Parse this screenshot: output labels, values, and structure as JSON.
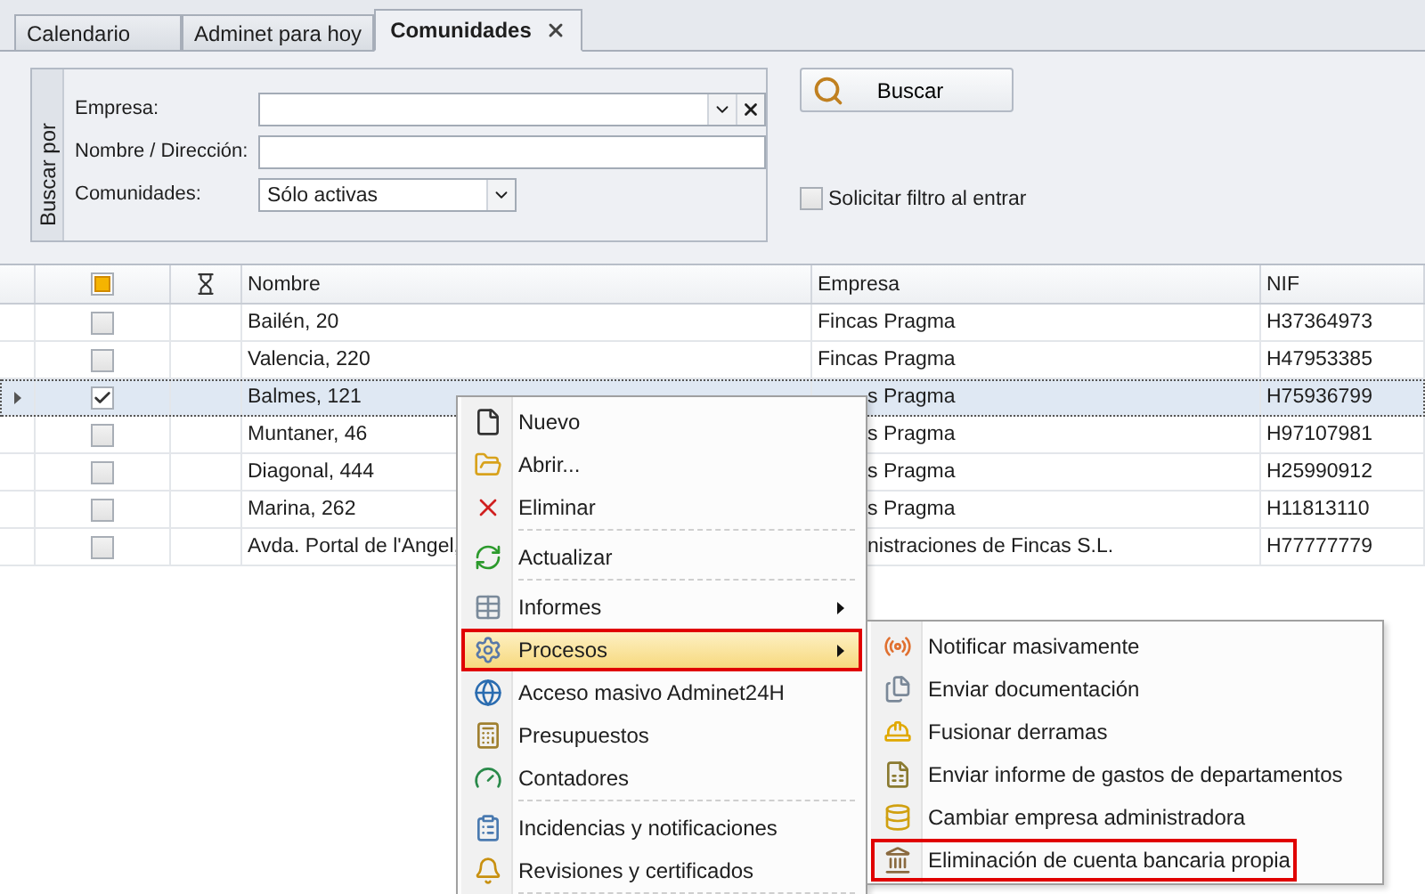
{
  "tabs": [
    {
      "label": "Calendario",
      "selected": false,
      "closable": false
    },
    {
      "label": "Adminet para hoy",
      "selected": false,
      "closable": false
    },
    {
      "label": "Comunidades",
      "selected": true,
      "closable": true
    }
  ],
  "search": {
    "group_label": "Buscar por",
    "fields": [
      {
        "label": "Empresa:",
        "kind": "combo_clear"
      },
      {
        "label": "Nombre / Dirección:",
        "kind": "text"
      },
      {
        "label": "Comunidades:",
        "kind": "select",
        "value": "Sólo activas"
      }
    ],
    "button": "Buscar",
    "checkbox": {
      "label": "Solicitar filtro al entrar",
      "checked": false
    }
  },
  "grid": {
    "header_partial_check": true,
    "columns": [
      "Nombre",
      "Empresa",
      "NIF"
    ],
    "rows": [
      {
        "nombre": "Bailén, 20",
        "empresa": "Fincas Pragma",
        "nif": "H37364973",
        "checked": false,
        "selected": false
      },
      {
        "nombre": "Valencia, 220",
        "empresa": "Fincas Pragma",
        "nif": "H47953385",
        "checked": false,
        "selected": false
      },
      {
        "nombre": "Balmes, 121",
        "empresa": "s Pragma",
        "nif": "H75936799",
        "checked": true,
        "selected": true
      },
      {
        "nombre": "Muntaner, 46",
        "empresa": "s Pragma",
        "nif": "H97107981",
        "checked": false,
        "selected": false
      },
      {
        "nombre": "Diagonal, 444",
        "empresa": "s Pragma",
        "nif": "H25990912",
        "checked": false,
        "selected": false
      },
      {
        "nombre": "Marina, 262",
        "empresa": "s Pragma",
        "nif": "H11813110",
        "checked": false,
        "selected": false
      },
      {
        "nombre": "Avda. Portal de l'Angel,",
        "empresa": "nistraciones de Fincas S.L.",
        "nif": "H77777779",
        "checked": false,
        "selected": false
      }
    ]
  },
  "context_menu": {
    "items": [
      {
        "label": "Nuevo",
        "submenu": false,
        "highlighted": false,
        "outlined": false,
        "separator_after": false
      },
      {
        "label": "Abrir...",
        "submenu": false,
        "highlighted": false,
        "outlined": false,
        "separator_after": false
      },
      {
        "label": "Eliminar",
        "submenu": false,
        "highlighted": false,
        "outlined": false,
        "separator_after": true
      },
      {
        "label": "Actualizar",
        "submenu": false,
        "highlighted": false,
        "outlined": false,
        "separator_after": true
      },
      {
        "label": "Informes",
        "submenu": true,
        "highlighted": false,
        "outlined": false,
        "separator_after": false
      },
      {
        "label": "Procesos",
        "submenu": true,
        "highlighted": true,
        "outlined": true,
        "separator_after": false
      },
      {
        "label": "Acceso masivo Adminet24H",
        "submenu": false,
        "highlighted": false,
        "outlined": false,
        "separator_after": false
      },
      {
        "label": "Presupuestos",
        "submenu": false,
        "highlighted": false,
        "outlined": false,
        "separator_after": false
      },
      {
        "label": "Contadores",
        "submenu": false,
        "highlighted": false,
        "outlined": false,
        "separator_after": true
      },
      {
        "label": "Incidencias y notificaciones",
        "submenu": false,
        "highlighted": false,
        "outlined": false,
        "separator_after": false
      },
      {
        "label": "Revisiones y certificados",
        "submenu": false,
        "highlighted": false,
        "outlined": false,
        "separator_after": true
      }
    ]
  },
  "submenu": {
    "items": [
      {
        "label": "Notificar masivamente",
        "outlined": false
      },
      {
        "label": "Enviar documentación",
        "outlined": false
      },
      {
        "label": "Fusionar derramas",
        "outlined": false
      },
      {
        "label": "Enviar informe de gastos de departamentos",
        "outlined": false
      },
      {
        "label": "Cambiar empresa administradora",
        "outlined": false
      },
      {
        "label": "Eliminación de cuenta bancaria propia",
        "outlined": true
      }
    ]
  }
}
